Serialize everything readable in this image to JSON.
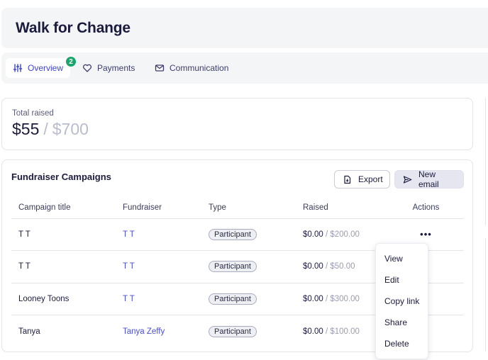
{
  "header": {
    "title": "Walk for Change"
  },
  "tabs": [
    {
      "label": "Overview",
      "icon": "sliders-icon",
      "active": true,
      "badge": "2"
    },
    {
      "label": "Payments",
      "icon": "heart-icon",
      "active": false
    },
    {
      "label": "Communication",
      "icon": "mail-icon",
      "active": false
    }
  ],
  "summary": {
    "label": "Total raised",
    "raised": "$55",
    "separator": "/",
    "goal": "$700"
  },
  "campaigns": {
    "title": "Fundraiser Campaigns",
    "export_label": "Export",
    "new_email_label": "New email",
    "columns": [
      "Campaign title",
      "Fundraiser",
      "Type",
      "Raised",
      "Actions"
    ],
    "rows": [
      {
        "title": "T T",
        "fundraiser": "T T",
        "type": "Participant",
        "raised": "$0.00",
        "goal": "/ $200.00",
        "actions": "•••"
      },
      {
        "title": "T T",
        "fundraiser": "T T",
        "type": "Participant",
        "raised": "$0.00",
        "goal": "/ $50.00",
        "actions": ""
      },
      {
        "title": "Looney Toons",
        "fundraiser": "T T",
        "type": "Participant",
        "raised": "$0.00",
        "goal": "/ $300.00",
        "actions": ""
      },
      {
        "title": "Tanya",
        "fundraiser": "Tanya Zeffy",
        "type": "Participant",
        "raised": "$0.00",
        "goal": "/ $100.00",
        "actions": ""
      }
    ]
  },
  "actions_menu": {
    "items": [
      "View",
      "Edit",
      "Copy link",
      "Share",
      "Delete"
    ]
  },
  "colors": {
    "accent": "#3d44c8",
    "badge": "#1aa56d",
    "muted": "#b9bccd"
  }
}
